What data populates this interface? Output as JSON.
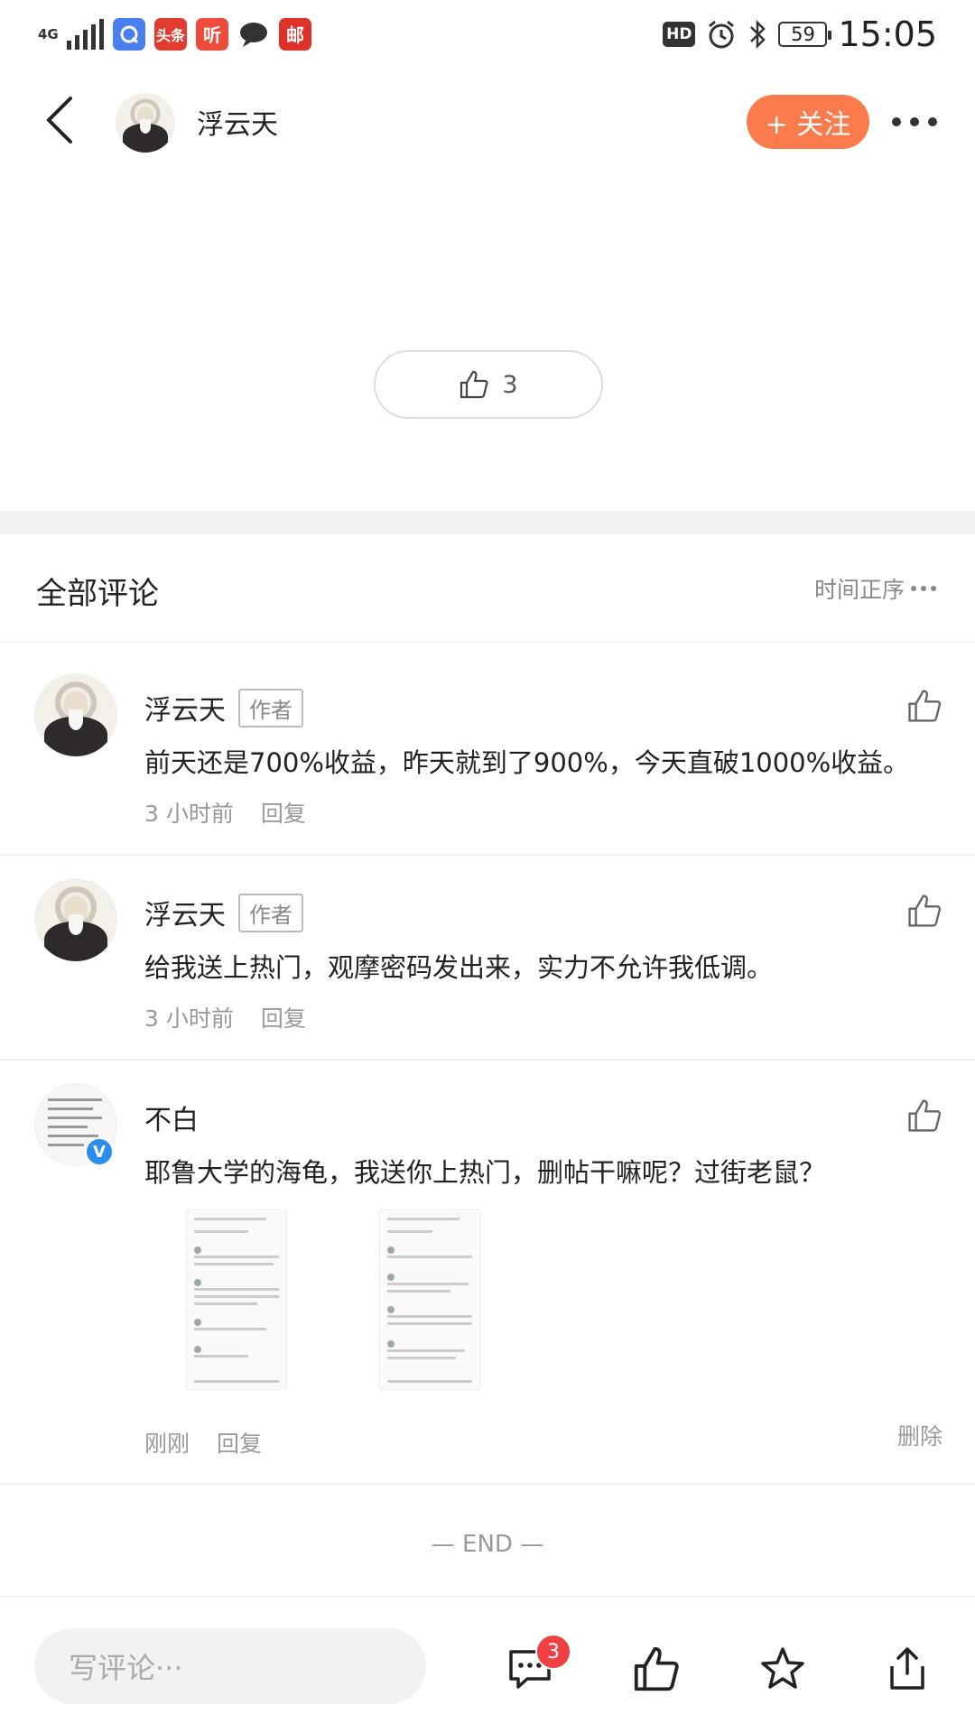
{
  "status_bar": {
    "network": "4G",
    "apps": [
      {
        "icon": "browser-app-icon",
        "label": "",
        "color": "#4a7ff0"
      },
      {
        "icon": "toutiao-app-icon",
        "label": "头条",
        "color": "#e23c2f"
      },
      {
        "icon": "listen-app-icon",
        "label": "听",
        "color": "#ef4b3c"
      },
      {
        "icon": "message-app-icon",
        "label": "",
        "color": "#333333"
      },
      {
        "icon": "mail-app-icon",
        "label": "邮",
        "color": "#e0302a"
      }
    ],
    "hd": "HD",
    "battery": "59",
    "time": "15:05"
  },
  "header": {
    "author_name": "浮云天",
    "follow_label": "+ 关注"
  },
  "post": {
    "like_count": "3"
  },
  "comments_section": {
    "title": "全部评论",
    "sort_label": "时间正序"
  },
  "comments": [
    {
      "name": "浮云天",
      "badge": "作者",
      "text": "前天还是700%收益，昨天就到了900%，今天直破1000%收益。",
      "time": "3 小时前",
      "reply": "回复"
    },
    {
      "name": "浮云天",
      "badge": "作者",
      "text": "给我送上热门，观摩密码发出来，实力不允许我低调。",
      "time": "3 小时前",
      "reply": "回复"
    },
    {
      "name": "不白",
      "text": "耶鲁大学的海龟，我送你上热门，删帖干嘛呢？过街老鼠？",
      "time": "刚刚",
      "reply": "回复",
      "delete": "删除",
      "verified": "V"
    }
  ],
  "end_label": "— END —",
  "bottom_bar": {
    "input_placeholder": "写评论···",
    "message_count": "3"
  },
  "colors": {
    "accent": "#fb7b4d",
    "badge_red": "#f04142",
    "verified_blue": "#2a8df0"
  }
}
